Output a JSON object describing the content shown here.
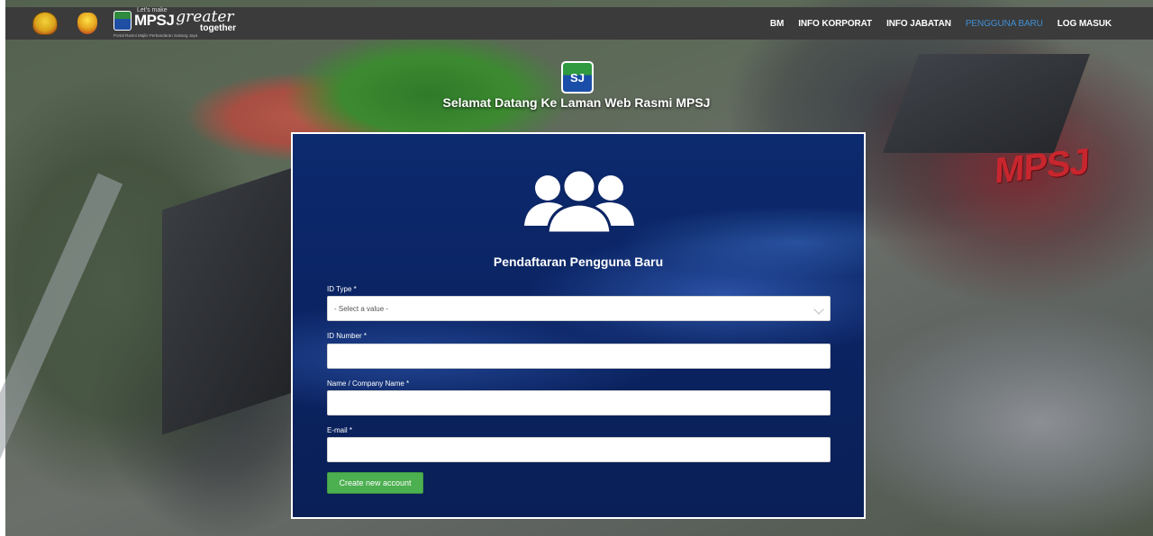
{
  "header": {
    "brand": {
      "lets_make": "Let's make",
      "name": "MPSJ",
      "greater": "greater",
      "together": "together",
      "portal": "Portal Rasmi Majlis Perbandaran Subang Jaya"
    },
    "nav": [
      {
        "label": "BM",
        "active": false
      },
      {
        "label": "INFO KORPORAT",
        "active": false
      },
      {
        "label": "INFO JABATAN",
        "active": false
      },
      {
        "label": "PENGGUNA BARU",
        "active": true
      },
      {
        "label": "LOG MASUK",
        "active": false
      }
    ]
  },
  "welcome": {
    "icon_text": "SJ",
    "title": "Selamat Datang Ke Laman Web Rasmi MPSJ"
  },
  "background": {
    "building_sign": "MPSJ"
  },
  "form": {
    "title": "Pendaftaran Pengguna Baru",
    "fields": {
      "id_type": {
        "label": "ID Type *",
        "value": "- Select a value -"
      },
      "id_number": {
        "label": "ID Number *",
        "value": ""
      },
      "name": {
        "label": "Name / Company Name *",
        "value": ""
      },
      "email": {
        "label": "E-mail *",
        "value": ""
      }
    },
    "submit_label": "Create new account"
  },
  "colors": {
    "header_bg": "#3b3b3b",
    "nav_active": "#3f8fd6",
    "panel_bg": "#0b2463",
    "button": "#4caf50"
  }
}
